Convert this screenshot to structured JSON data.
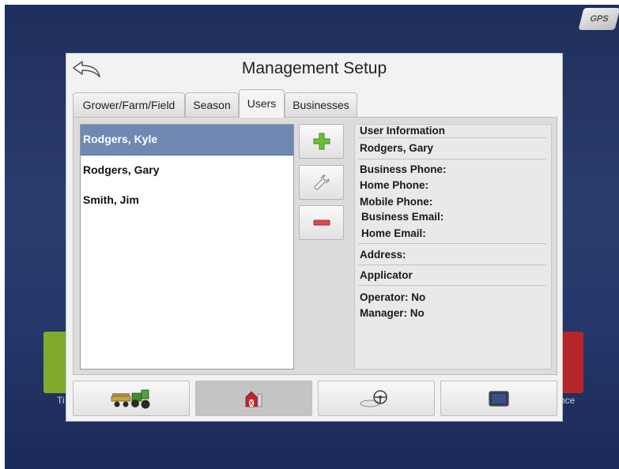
{
  "background": {
    "gps_badge": "GPS",
    "left_tile_label": "Ti",
    "right_tile_label": "nce"
  },
  "dialog": {
    "title": "Management Setup",
    "back_icon": "back-arrow-icon",
    "tabs": [
      {
        "label": "Grower/Farm/Field",
        "active": false
      },
      {
        "label": "Season",
        "active": false
      },
      {
        "label": "Users",
        "active": true
      },
      {
        "label": "Businesses",
        "active": false
      }
    ],
    "users": [
      "Rodgers, Kyle",
      "Rodgers, Gary",
      "Smith, Jim"
    ],
    "selected_user": "Rodgers, Kyle",
    "actions": {
      "add_icon": "plus-icon",
      "edit_icon": "wrench-icon",
      "remove_icon": "minus-icon"
    },
    "info": {
      "heading": "User Information",
      "name": "Rodgers, Gary",
      "business_phone": "Business Phone:",
      "home_phone": "Home Phone:",
      "mobile_phone": "Mobile Phone:",
      "business_email": "Business Email:",
      "home_email": "Home Email:",
      "address": "Address:",
      "applicator": "Applicator",
      "operator": "Operator: No",
      "manager": "Manager: No"
    },
    "bottom_nav": [
      {
        "icon": "tractor-implement-icon",
        "active": false
      },
      {
        "icon": "barn-icon",
        "active": true
      },
      {
        "icon": "steering-wheel-icon",
        "active": false
      },
      {
        "icon": "display-icon",
        "active": false
      }
    ]
  },
  "colors": {
    "selected_row": "#6f89b3",
    "add_green": "#5fb832",
    "remove_red": "#d9434a",
    "barn_red": "#c0262c"
  }
}
